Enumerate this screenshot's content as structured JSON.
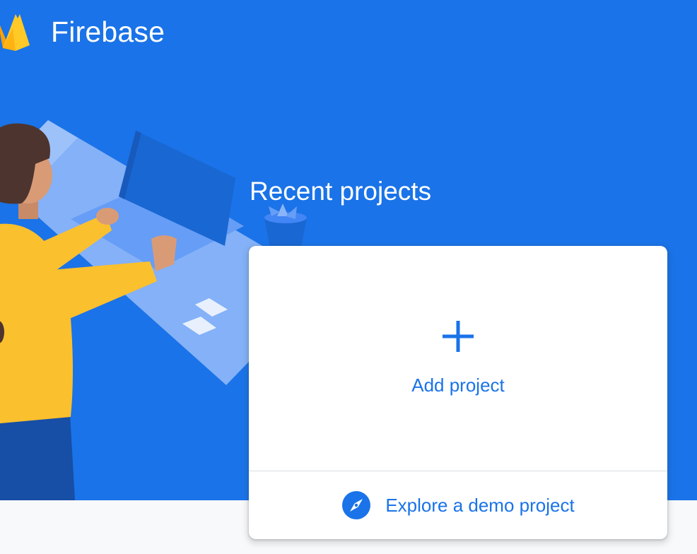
{
  "header": {
    "brand_name": "Firebase",
    "logo_icon": "firebase-flame-icon"
  },
  "main": {
    "section_title": "Recent projects",
    "add_project": {
      "label": "Add project",
      "icon": "plus-icon"
    },
    "demo_project": {
      "label": "Explore a demo project",
      "icon": "compass-icon"
    }
  },
  "colors": {
    "hero_background": "#1a73e8",
    "accent": "#1a73e8",
    "card_background": "#ffffff",
    "page_background": "#f8f9fa",
    "logo_yellow": "#ffca28",
    "logo_orange": "#ffa000"
  }
}
